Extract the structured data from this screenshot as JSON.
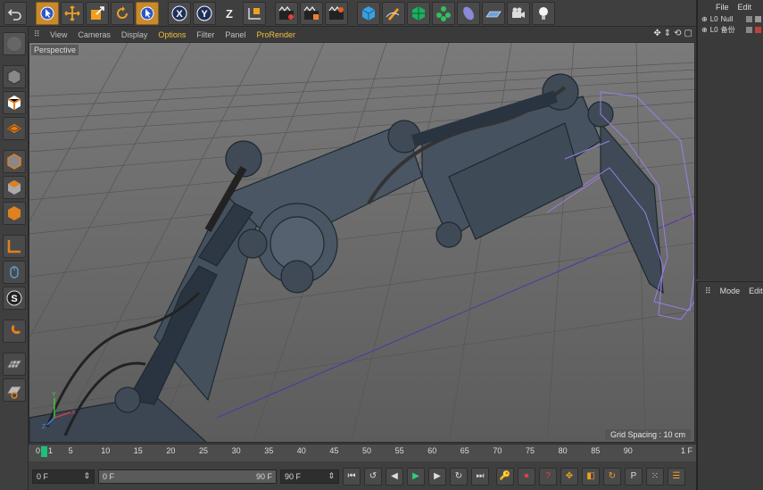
{
  "toolbar": {
    "buttons": [
      {
        "icon": "undo-icon"
      },
      {
        "icon": "live-select-icon"
      },
      {
        "icon": "move-icon"
      },
      {
        "icon": "scale-icon"
      },
      {
        "icon": "rotate-icon"
      },
      {
        "icon": "recent-tool-icon"
      },
      {
        "icon": "x-axis-icon",
        "label": "X"
      },
      {
        "icon": "y-axis-icon",
        "label": "Y"
      },
      {
        "icon": "z-axis-icon",
        "label": "Z"
      },
      {
        "icon": "coordinate-system-icon"
      },
      {
        "icon": "render-view-icon"
      },
      {
        "icon": "render-picture-viewer-icon"
      },
      {
        "icon": "render-settings-icon"
      },
      {
        "icon": "cube-icon"
      },
      {
        "icon": "pen-icon"
      },
      {
        "icon": "subdivision-icon"
      },
      {
        "icon": "cloner-icon"
      },
      {
        "icon": "deformer-icon"
      },
      {
        "icon": "floor-icon"
      },
      {
        "icon": "camera-icon"
      },
      {
        "icon": "light-icon"
      }
    ]
  },
  "viewport_menu": {
    "items": [
      "View",
      "Cameras",
      "Display",
      "Options",
      "Filter",
      "Panel",
      "ProRender"
    ],
    "active": "Options"
  },
  "viewport": {
    "label": "Perspective",
    "grid_spacing": "Grid Spacing : 10 cm",
    "axis_labels": [
      "Y",
      "X",
      "Z"
    ]
  },
  "left_tools": [
    "make-editable-icon",
    "model-mode-icon",
    "texture-mode-icon",
    "points-mode-icon",
    "edges-mode-icon",
    "polygons-mode-icon",
    "axis-mode-icon",
    "tweak-mode-icon",
    "solo-icon",
    "snap-icon",
    "workplane-icon",
    "locked-workplane-icon"
  ],
  "timeline": {
    "ticks": [
      "0",
      "5",
      "10",
      "15",
      "20",
      "25",
      "30",
      "35",
      "40",
      "45",
      "50",
      "55",
      "60",
      "65",
      "70",
      "75",
      "80",
      "85",
      "90"
    ],
    "current_frame": "1",
    "frame_display": "1 F"
  },
  "transport": {
    "start_field": "0 F",
    "range_start": "0 F",
    "range_end": "90 F",
    "end_field": "90 F"
  },
  "objects_panel": {
    "menu": [
      "File",
      "Edit"
    ],
    "objects": [
      {
        "label": "Null"
      },
      {
        "label": "备份"
      }
    ]
  },
  "attributes_panel": {
    "menu": [
      "Mode",
      "Edit"
    ]
  },
  "colors": {
    "accent": "#c98a2d",
    "menu_highlight": "#f0c040",
    "playhead": "#1fc07a",
    "viewport_bg": "#6a6a6a",
    "selection_outline": "#9a7ee8"
  }
}
